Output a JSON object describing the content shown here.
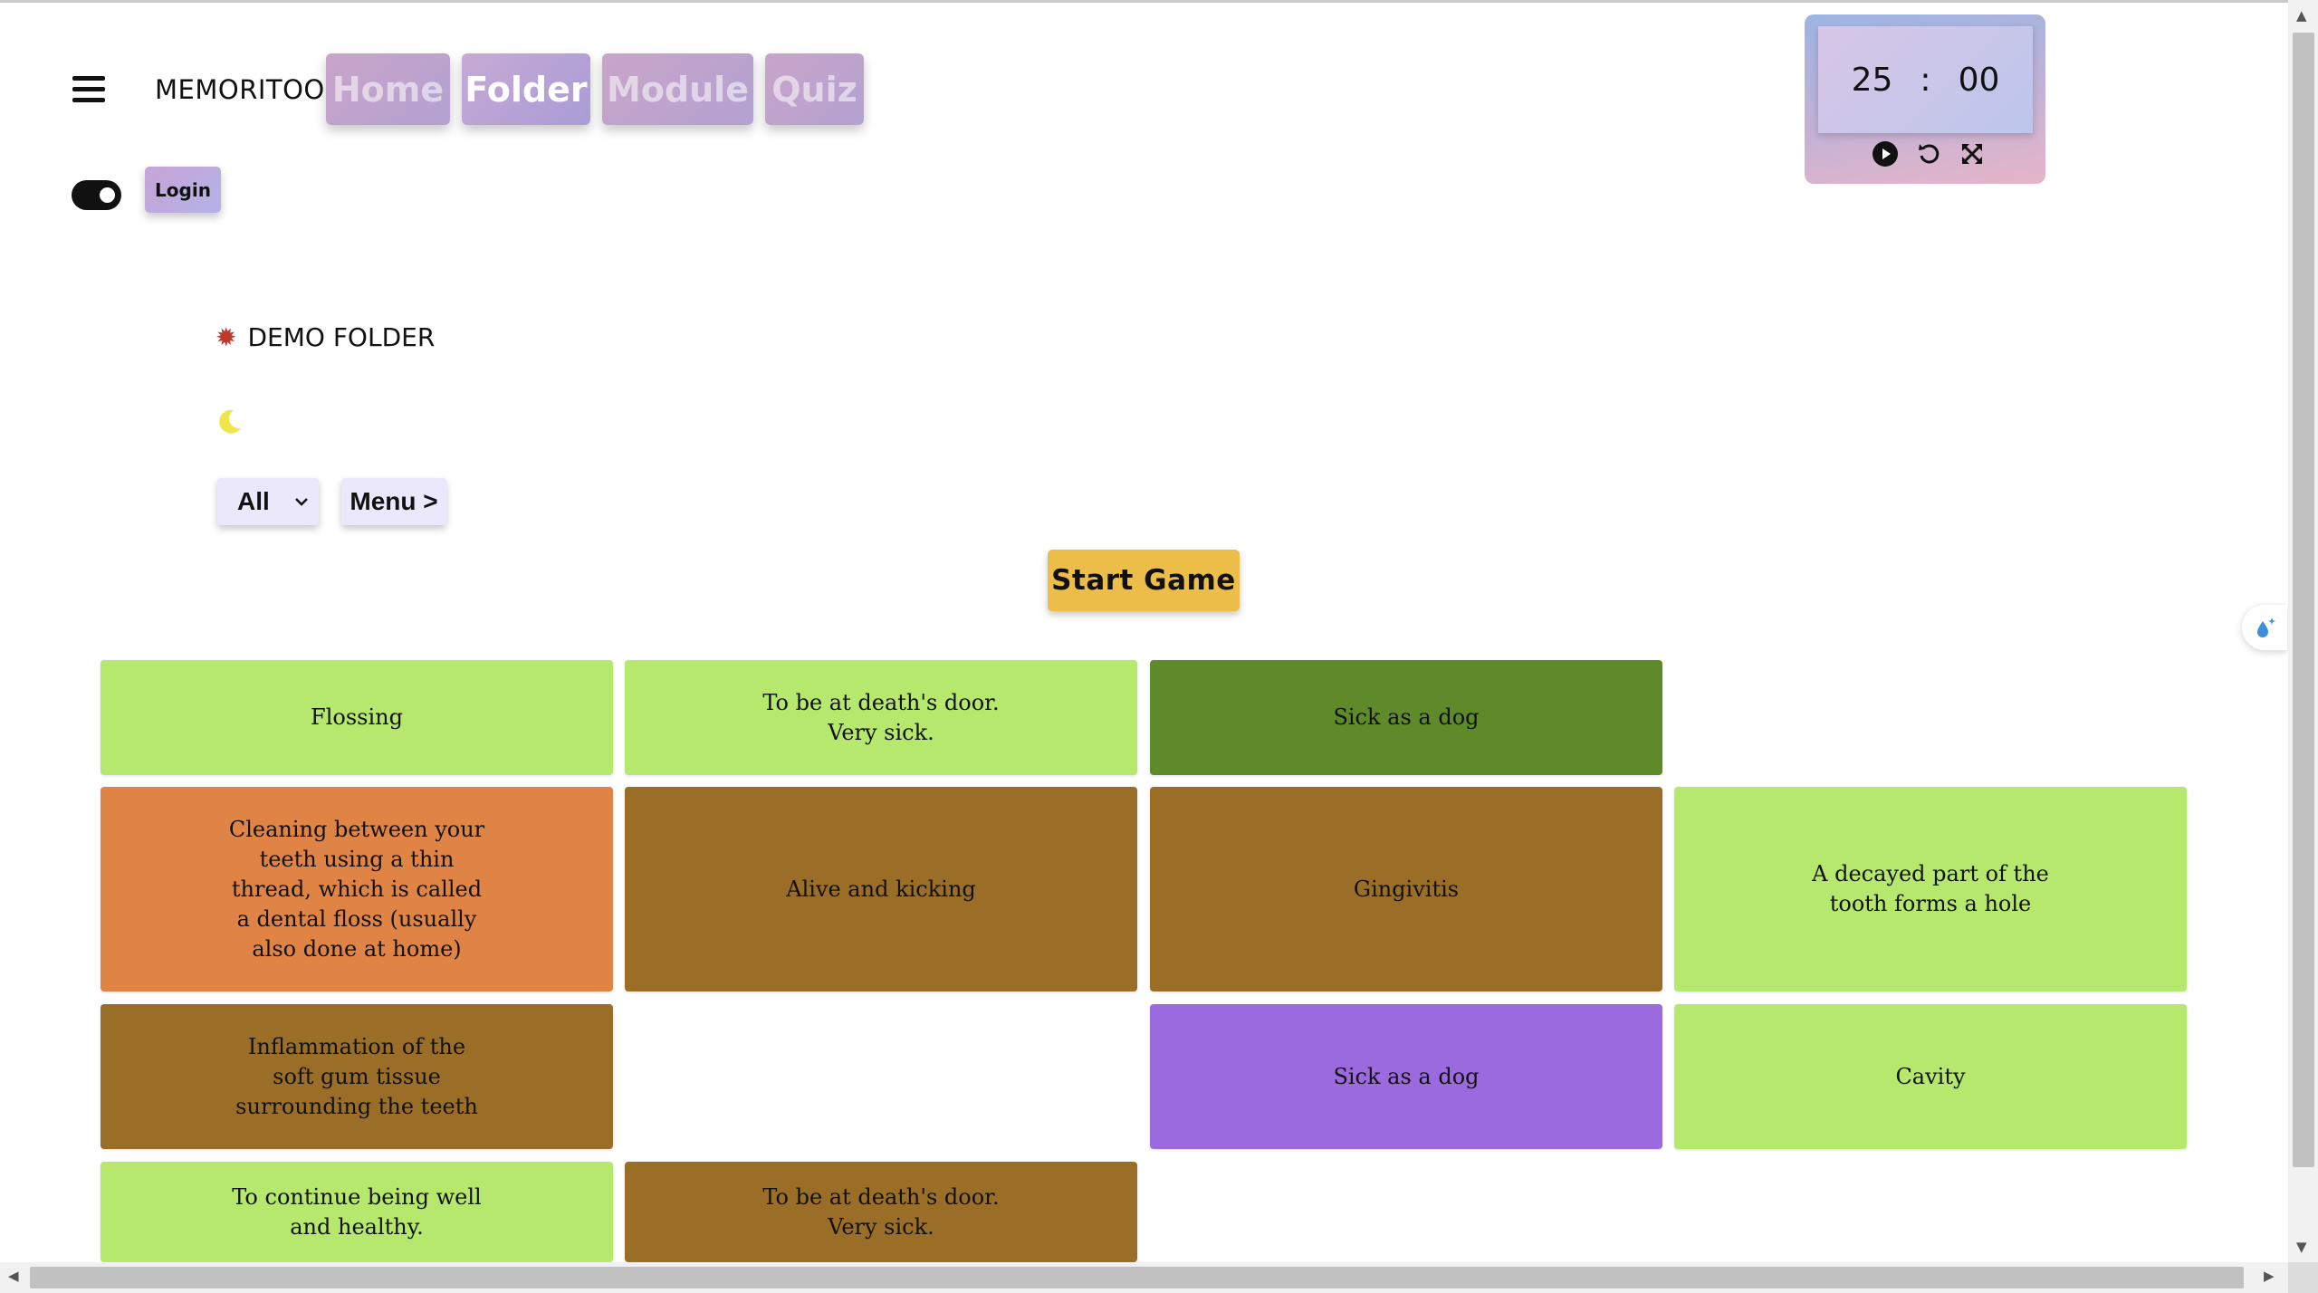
{
  "nav": {
    "brand": "MEMORITOO",
    "buttons": [
      {
        "label": "Home",
        "active": false
      },
      {
        "label": "Folder",
        "active": true
      },
      {
        "label": "Module",
        "active": false
      },
      {
        "label": "Quiz",
        "active": false
      }
    ],
    "login_label": "Login"
  },
  "timer": {
    "minutes": "25",
    "separator": ":",
    "seconds": "00"
  },
  "folder": {
    "title": "DEMO FOLDER"
  },
  "controls": {
    "filter_value": "All",
    "menu_label": "Menu >",
    "start_label": "Start Game"
  },
  "cards": [
    {
      "text": "Flossing",
      "color": "#b5e86c"
    },
    {
      "text": "To be at death's door.\nVery sick.",
      "color": "#b5e86c"
    },
    {
      "text": "Sick as a dog",
      "color": "#5e8a29"
    },
    {
      "text": "Cleaning between your\nteeth using a thin\nthread, which is called\na dental floss (usually\nalso done at home)",
      "color": "#e08446"
    },
    {
      "text": "Alive and kicking",
      "color": "#9b6e28"
    },
    {
      "text": "Gingivitis",
      "color": "#9b6e28"
    },
    {
      "text": "A decayed part of the\ntooth forms a hole",
      "color": "#b5e86c"
    },
    {
      "text": "Inflammation of the\nsoft gum tissue\nsurrounding the teeth",
      "color": "#9b6e28"
    },
    {
      "text": "Sick as a dog",
      "color": "#9b6ade"
    },
    {
      "text": "Cavity",
      "color": "#b5e86c"
    },
    {
      "text": "To continue being well\nand healthy.",
      "color": "#b5e86c"
    },
    {
      "text": "To be at death's door.\nVery sick.",
      "color": "#9b6e28"
    }
  ]
}
